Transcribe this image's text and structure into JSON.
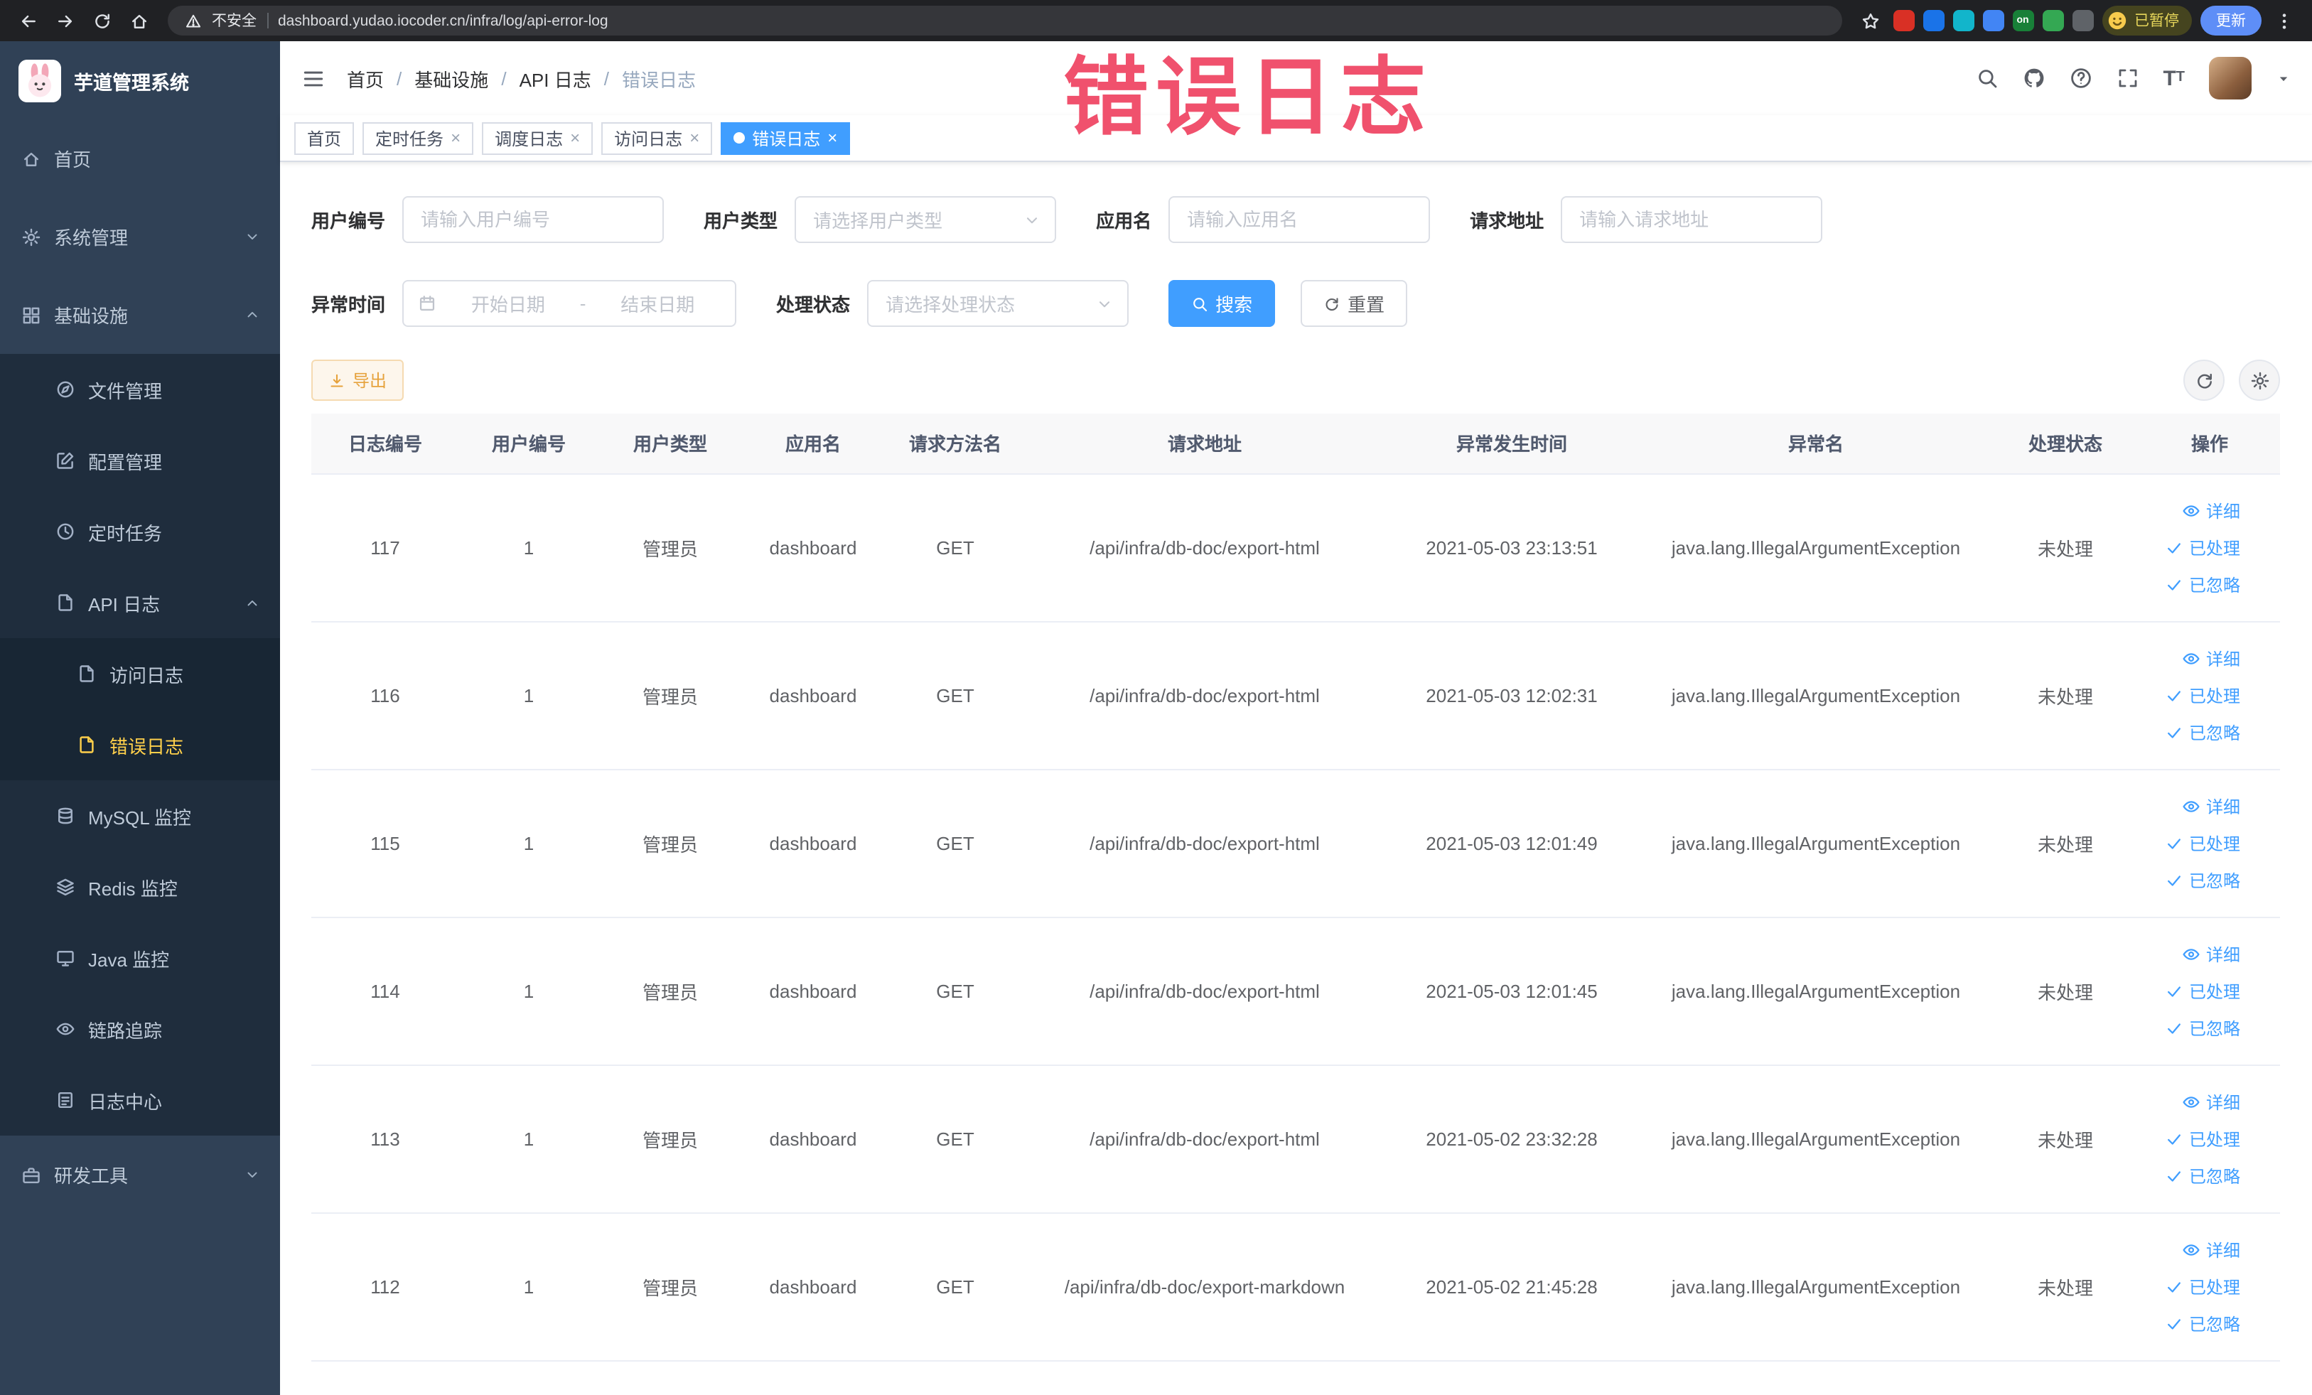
{
  "watermark": "错误日志",
  "colors": {
    "primary": "#409eff",
    "sidebar_bg": "#304156",
    "submenu_bg": "#1f2d3d",
    "menu_active": "#ffd04b",
    "watermark": "#f0516d",
    "export_warning": "#e6a23c",
    "link_blue": "#409eff"
  },
  "browser": {
    "security_label": "不安全",
    "url": "dashboard.yudao.iocoder.cn/infra/log/api-error-log",
    "profile_label": "已暂停",
    "update_label": "更新",
    "nav_icons": [
      "back-icon",
      "forward-icon",
      "reload-icon",
      "home-icon"
    ],
    "right_icons": [
      "star-icon",
      "kebab-menu-icon"
    ],
    "extensions": [
      {
        "key": "ext-1",
        "color": "#d93025"
      },
      {
        "key": "ext-2",
        "color": "#1a73e8"
      },
      {
        "key": "ext-3",
        "color": "#12b5cb"
      },
      {
        "key": "ext-4",
        "color": "#4285f4"
      },
      {
        "key": "ext-5",
        "color": "#188038",
        "label": "on"
      },
      {
        "key": "ext-6",
        "color": "#34a853"
      },
      {
        "key": "ext-7",
        "color": "#5f6368"
      }
    ]
  },
  "sidebar": {
    "app_title": "芋道管理系统",
    "menu": [
      {
        "key": "home",
        "label": "首页",
        "icon": "home-icon",
        "level": 1
      },
      {
        "key": "system",
        "label": "系统管理",
        "icon": "gear-icon",
        "level": 1,
        "expandable": true,
        "expanded": false
      },
      {
        "key": "infra",
        "label": "基础设施",
        "icon": "grid-icon",
        "level": 1,
        "expandable": true,
        "expanded": true
      },
      {
        "key": "file",
        "label": "文件管理",
        "icon": "compass-icon",
        "level": 2
      },
      {
        "key": "config",
        "label": "配置管理",
        "icon": "edit-icon",
        "level": 2
      },
      {
        "key": "job",
        "label": "定时任务",
        "icon": "clock-icon",
        "level": 2
      },
      {
        "key": "api-log",
        "label": "API 日志",
        "icon": "docpen-icon",
        "level": 2,
        "expandable": true,
        "expanded": true
      },
      {
        "key": "access-log",
        "label": "访问日志",
        "icon": "docpen-icon",
        "level": 3
      },
      {
        "key": "error-log",
        "label": "错误日志",
        "icon": "docpen-icon",
        "level": 3,
        "active": true
      },
      {
        "key": "mysql",
        "label": "MySQL 监控",
        "icon": "db-icon",
        "level": 2
      },
      {
        "key": "redis",
        "label": "Redis 监控",
        "icon": "layers-icon",
        "level": 2
      },
      {
        "key": "java",
        "label": "Java 监控",
        "icon": "monitor-icon",
        "level": 2
      },
      {
        "key": "trace",
        "label": "链路追踪",
        "icon": "eye-icon",
        "level": 2
      },
      {
        "key": "log-center",
        "label": "日志中心",
        "icon": "docs-icon",
        "level": 2
      },
      {
        "key": "dev-tools",
        "label": "研发工具",
        "icon": "case-icon",
        "level": 1,
        "expandable": true,
        "expanded": false
      }
    ]
  },
  "navbar": {
    "breadcrumb": [
      "首页",
      "基础设施",
      "API 日志",
      "错误日志"
    ],
    "right_icons": [
      "search-icon",
      "github-icon",
      "question-icon",
      "fullscreen-icon",
      "fontsize-icon",
      "avatar",
      "caret-down-icon"
    ]
  },
  "tabs": [
    {
      "key": "home",
      "label": "首页",
      "closable": false,
      "active": false
    },
    {
      "key": "job",
      "label": "定时任务",
      "closable": true,
      "active": false
    },
    {
      "key": "job-log",
      "label": "调度日志",
      "closable": true,
      "active": false
    },
    {
      "key": "access-log",
      "label": "访问日志",
      "closable": true,
      "active": false
    },
    {
      "key": "error-log",
      "label": "错误日志",
      "closable": true,
      "active": true
    }
  ],
  "filters": {
    "user_id": {
      "label": "用户编号",
      "placeholder": "请输入用户编号"
    },
    "user_type": {
      "label": "用户类型",
      "placeholder": "请选择用户类型"
    },
    "app_name": {
      "label": "应用名",
      "placeholder": "请输入应用名"
    },
    "request_url": {
      "label": "请求地址",
      "placeholder": "请输入请求地址"
    },
    "exception_time": {
      "label": "异常时间",
      "start_placeholder": "开始日期",
      "separator": "-",
      "end_placeholder": "结束日期"
    },
    "process_status": {
      "label": "处理状态",
      "placeholder": "请选择处理状态"
    },
    "search_label": "搜索",
    "reset_label": "重置"
  },
  "toolbar": {
    "export_label": "导出",
    "icon_buttons": [
      "refresh-icon",
      "gear-icon"
    ]
  },
  "table": {
    "headers": [
      "日志编号",
      "用户编号",
      "用户类型",
      "应用名",
      "请求方法名",
      "请求地址",
      "异常发生时间",
      "异常名",
      "处理状态",
      "操作"
    ],
    "actions": [
      {
        "key": "detail",
        "label": "详细",
        "icon": "eye-icon"
      },
      {
        "key": "processed",
        "label": "已处理",
        "icon": "check-icon"
      },
      {
        "key": "ignored",
        "label": "已忽略",
        "icon": "check-icon"
      }
    ],
    "rows": [
      {
        "id": "117",
        "user_id": "1",
        "user_type": "管理员",
        "app": "dashboard",
        "method": "GET",
        "url": "/api/infra/db-doc/export-html",
        "time": "2021-05-03 23:13:51",
        "exception": "java.lang.IllegalArgumentException",
        "status": "未处理"
      },
      {
        "id": "116",
        "user_id": "1",
        "user_type": "管理员",
        "app": "dashboard",
        "method": "GET",
        "url": "/api/infra/db-doc/export-html",
        "time": "2021-05-03 12:02:31",
        "exception": "java.lang.IllegalArgumentException",
        "status": "未处理"
      },
      {
        "id": "115",
        "user_id": "1",
        "user_type": "管理员",
        "app": "dashboard",
        "method": "GET",
        "url": "/api/infra/db-doc/export-html",
        "time": "2021-05-03 12:01:49",
        "exception": "java.lang.IllegalArgumentException",
        "status": "未处理"
      },
      {
        "id": "114",
        "user_id": "1",
        "user_type": "管理员",
        "app": "dashboard",
        "method": "GET",
        "url": "/api/infra/db-doc/export-html",
        "time": "2021-05-03 12:01:45",
        "exception": "java.lang.IllegalArgumentException",
        "status": "未处理"
      },
      {
        "id": "113",
        "user_id": "1",
        "user_type": "管理员",
        "app": "dashboard",
        "method": "GET",
        "url": "/api/infra/db-doc/export-html",
        "time": "2021-05-02 23:32:28",
        "exception": "java.lang.IllegalArgumentException",
        "status": "未处理"
      },
      {
        "id": "112",
        "user_id": "1",
        "user_type": "管理员",
        "app": "dashboard",
        "method": "GET",
        "url": "/api/infra/db-doc/export-markdown",
        "time": "2021-05-02 21:45:28",
        "exception": "java.lang.IllegalArgumentException",
        "status": "未处理"
      }
    ]
  }
}
